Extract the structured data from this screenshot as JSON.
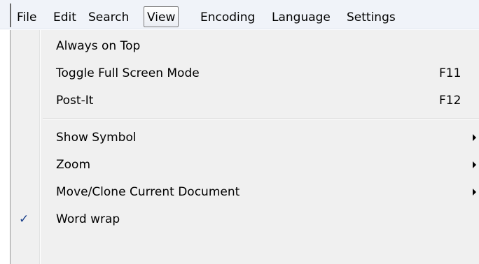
{
  "menubar": {
    "items": [
      {
        "label": "File"
      },
      {
        "label": "Edit"
      },
      {
        "label": "Search"
      },
      {
        "label": "View"
      },
      {
        "label": "Encoding"
      },
      {
        "label": "Language"
      },
      {
        "label": "Settings"
      }
    ],
    "active_item": "View"
  },
  "view_menu": {
    "items": [
      {
        "label": "Always on Top",
        "shortcut": "",
        "checked": false,
        "submenu": false
      },
      {
        "label": "Toggle Full Screen Mode",
        "shortcut": "F11",
        "checked": false,
        "submenu": false
      },
      {
        "label": "Post-It",
        "shortcut": "F12",
        "checked": false,
        "submenu": false
      },
      {
        "label": "Show Symbol",
        "shortcut": "",
        "checked": false,
        "submenu": true
      },
      {
        "label": "Zoom",
        "shortcut": "",
        "checked": false,
        "submenu": true
      },
      {
        "label": "Move/Clone Current Document",
        "shortcut": "",
        "checked": false,
        "submenu": true
      },
      {
        "label": "Word wrap",
        "shortcut": "",
        "checked": true,
        "submenu": false
      }
    ],
    "check_mark": "✓"
  },
  "colors": {
    "menubar_background": "#f0f3f9",
    "menu_background": "#f0f0f0",
    "check_mark": "#1a3f8a"
  }
}
